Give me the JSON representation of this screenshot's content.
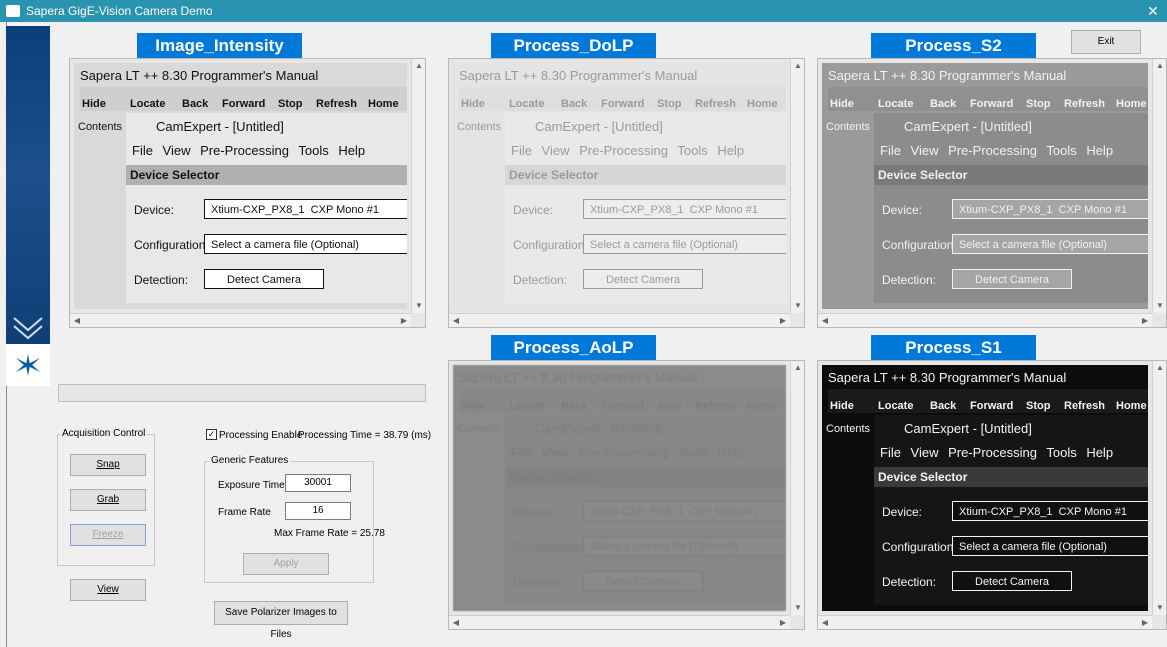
{
  "window": {
    "title": "Sapera GigE-Vision Camera Demo",
    "close_glyph": "✕"
  },
  "labels": {
    "intensity": "Image_Intensity",
    "dolp": "Process_DoLP",
    "s2": "Process_S2",
    "aolp": "Process_AoLP",
    "s1": "Process_S1"
  },
  "exit_label": "Exit",
  "preview": {
    "app_title": "Sapera LT ++ 8.30 Programmer's Manual",
    "toolbar": [
      "Hide",
      "Locate",
      "Back",
      "Forward",
      "Stop",
      "Refresh",
      "Home"
    ],
    "contents": "Contents",
    "dialog_title": "CamExpert - [Untitled]",
    "menu": "File View Pre-Processing Tools Help",
    "device_selector": "Device Selector",
    "device_label": "Device:",
    "device_value": "Xtium-CXP_PX8_1",
    "device_camera": "CXP Mono #1",
    "config_label": "Configuration:",
    "config_value": "Select a camera file (Optional)",
    "detection_label": "Detection:",
    "detect_button": "Detect Camera"
  },
  "acquisition": {
    "title": "Acquisition Control",
    "snap": "Snap",
    "grab": "Grab",
    "freeze": "Freeze",
    "view": "View"
  },
  "processing": {
    "enable_label": "Processing Enable",
    "enabled": true,
    "time_text": "Processing Time = 38.79 (ms)"
  },
  "generic": {
    "title": "Generic Features",
    "exposure_label": "Exposure Time(us)",
    "exposure_value": "30001",
    "frame_rate_label": "Frame Rate",
    "frame_rate_value": "16",
    "max_frame_rate": "Max Frame Rate = 25.78",
    "apply": "Apply"
  },
  "save_button": "Save Polarizer Images to Files",
  "colors": {
    "titlebar": "#2a93b0",
    "label_bg": "#0078d7",
    "sidebar": "#0d3b70"
  }
}
